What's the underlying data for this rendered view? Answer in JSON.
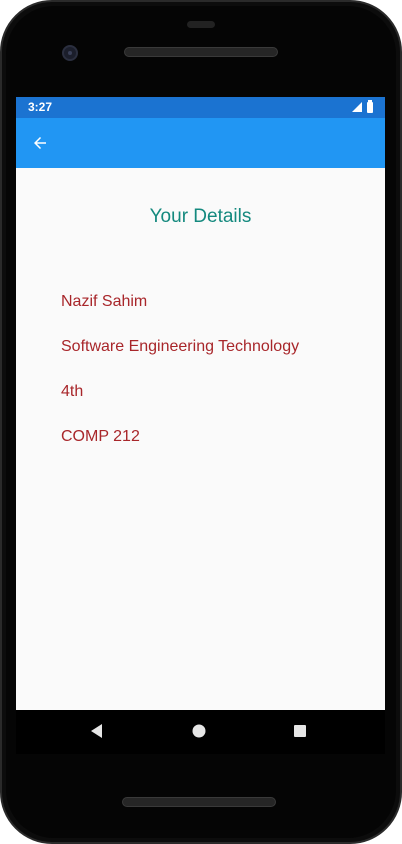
{
  "status_bar": {
    "time": "3:27"
  },
  "app_bar": {
    "back_icon": "arrow-left-icon"
  },
  "page": {
    "title": "Your Details"
  },
  "details": [
    "Nazif Sahim",
    "Software Engineering Technology",
    "4th",
    "COMP 212"
  ],
  "nav_bar": {
    "back_icon": "triangle-back-icon",
    "home_icon": "circle-home-icon",
    "recents_icon": "square-recents-icon"
  },
  "colors": {
    "status_bar": "#1b73d1",
    "app_bar": "#2196f3",
    "title": "#14897e",
    "detail_text": "#a8262a",
    "background": "#fafafa"
  }
}
